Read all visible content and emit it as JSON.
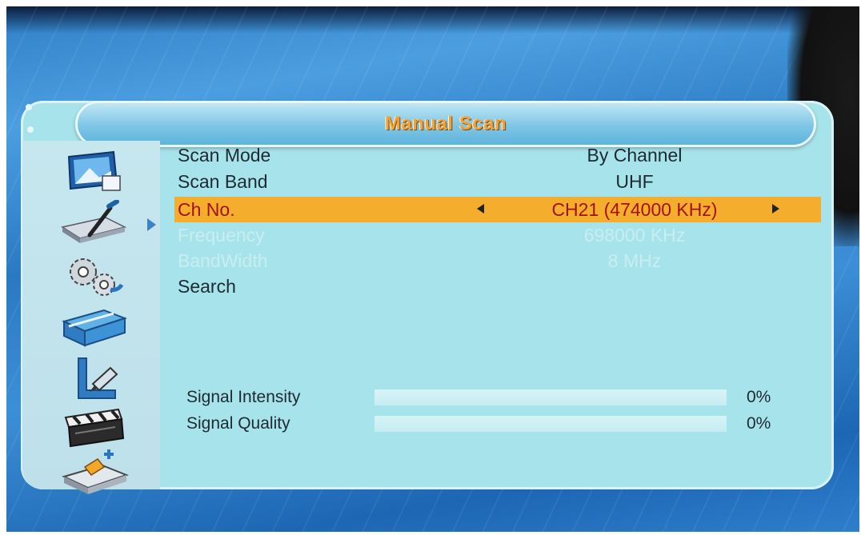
{
  "dialog": {
    "title": "Manual Scan"
  },
  "sidebar": {
    "icons": [
      "picture-icon",
      "installation-dish-icon",
      "system-gears-icon",
      "tools-toolbox-icon",
      "parental-ruler-icon",
      "media-clapper-icon",
      "storage-usb-icon"
    ],
    "selected_index": 1
  },
  "menu": {
    "scan_mode": {
      "label": "Scan Mode",
      "value": "By Channel"
    },
    "scan_band": {
      "label": "Scan Band",
      "value": "UHF"
    },
    "channel": {
      "label": "Ch No.",
      "value": "CH21 (474000 KHz)"
    },
    "frequency": {
      "label": "Frequency",
      "value": "698000 KHz"
    },
    "bandwidth": {
      "label": "BandWidth",
      "value": "8 MHz"
    },
    "search": {
      "label": "Search"
    }
  },
  "signal": {
    "intensity": {
      "label": "Signal Intensity",
      "percent_text": "0%",
      "percent": 0
    },
    "quality": {
      "label": "Signal Quality",
      "percent_text": "0%",
      "percent": 0
    }
  },
  "colors": {
    "highlight": "#f4ad2c",
    "panel": "#a7e3ea",
    "title_text": "#f2a23a"
  }
}
